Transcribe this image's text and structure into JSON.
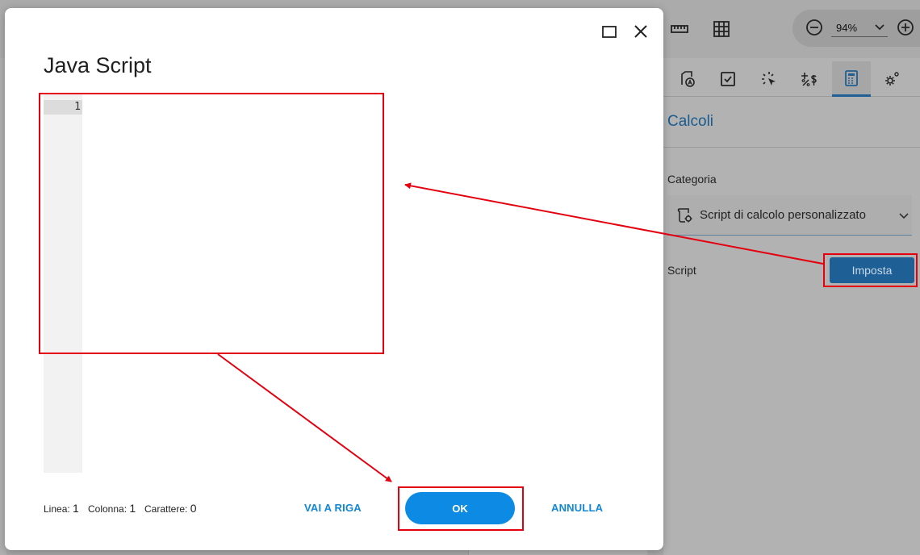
{
  "background_app": {
    "toolbar_icons": [
      "ruler-icon",
      "grid-icon"
    ],
    "zoom": {
      "value": "94%",
      "minus_icon": "zoom-out-icon",
      "plus_icon": "zoom-in-icon"
    },
    "panel": {
      "tabs": [
        "form-field-icon",
        "checkbox-icon",
        "cursor-click-icon",
        "currency-percent-icon",
        "calculator-icon",
        "settings-gear-icon"
      ],
      "active_tab": "calculator-icon",
      "title": "Calcoli",
      "category_label": "Categoria",
      "category_value": "Script di calcolo personalizzato",
      "script_label": "Script",
      "set_button": "Imposta"
    }
  },
  "dialog": {
    "title": "Java Script",
    "editor": {
      "line_numbers": [
        "1"
      ],
      "content": ""
    },
    "status": {
      "line_label": "Linea:",
      "line_value": "1",
      "column_label": "Colonna:",
      "column_value": "1",
      "chars_label": "Carattere:",
      "chars_value": "0"
    },
    "buttons": {
      "goto_line": "VAI A RIGA",
      "ok": "OK",
      "cancel": "ANNULLA"
    }
  },
  "colors": {
    "accent": "#0d8ae3",
    "annotation": "#e4000f",
    "panel_title": "#1b5b8f"
  }
}
